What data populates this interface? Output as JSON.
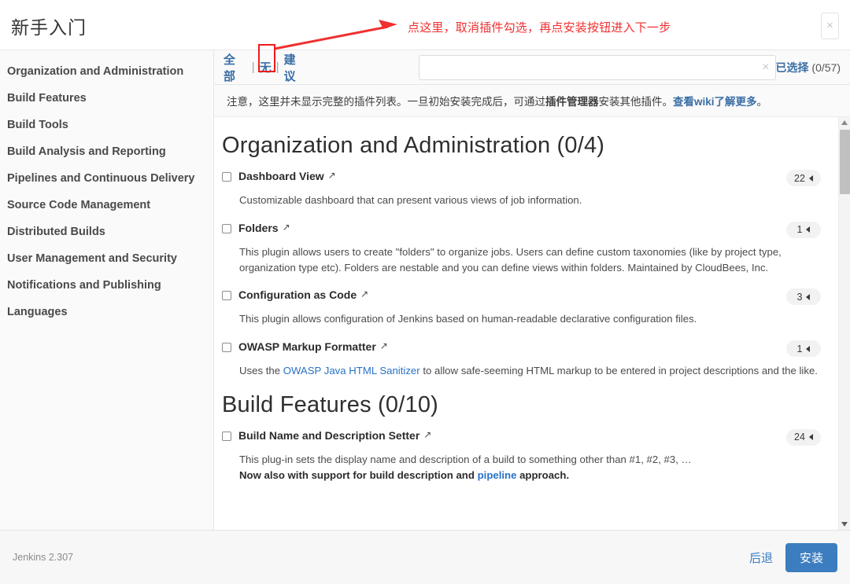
{
  "header": {
    "title": "新手入门",
    "close_label": "×",
    "annotation": "点这里，取消插件勾选，再点安装按钮进入下一步"
  },
  "sidebar": {
    "items": [
      {
        "label": "Organization and Administration"
      },
      {
        "label": "Build Features"
      },
      {
        "label": "Build Tools"
      },
      {
        "label": "Build Analysis and Reporting"
      },
      {
        "label": "Pipelines and Continuous Delivery"
      },
      {
        "label": "Source Code Management"
      },
      {
        "label": "Distributed Builds"
      },
      {
        "label": "User Management and Security"
      },
      {
        "label": "Notifications and Publishing"
      },
      {
        "label": "Languages"
      }
    ]
  },
  "filter_bar": {
    "tab_all": "全部",
    "tab_none": "无",
    "tab_suggested": "建议",
    "separator": "|",
    "search_value": "",
    "search_placeholder": "",
    "clear_label": "×",
    "selected_link": "已选择",
    "selected_count": " (0/57)"
  },
  "notice": {
    "part1": "注意，这里并未显示完整的插件列表。一旦初始安装完成后，可通过",
    "bold": "插件管理器",
    "part2": "安装其他插件。",
    "link": "查看wiki了解更多",
    "part3": "。"
  },
  "categories": [
    {
      "title": "Organization and Administration (0/4)",
      "plugins": [
        {
          "name": "Dashboard View",
          "ext_icon": "↗",
          "version": "22",
          "desc_pre": "Customizable dashboard that can present various views of job information.",
          "desc_link": "",
          "desc_post": "",
          "desc_bold": ""
        },
        {
          "name": "Folders",
          "ext_icon": "↗",
          "version": "1",
          "desc_pre": "This plugin allows users to create \"folders\" to organize jobs. Users can define custom taxonomies (like by project type, organization type etc). Folders are nestable and you can define views within folders. Maintained by CloudBees, Inc.",
          "desc_link": "",
          "desc_post": "",
          "desc_bold": ""
        },
        {
          "name": "Configuration as Code",
          "ext_icon": "↗",
          "version": "3",
          "desc_pre": "This plugin allows configuration of Jenkins based on human-readable declarative configuration files.",
          "desc_link": "",
          "desc_post": "",
          "desc_bold": ""
        },
        {
          "name": "OWASP Markup Formatter",
          "ext_icon": "↗",
          "version": "1",
          "desc_pre": "Uses the ",
          "desc_link": "OWASP Java HTML Sanitizer",
          "desc_post": " to allow safe-seeming HTML markup to be entered in project descriptions and the like.",
          "desc_bold": ""
        }
      ]
    },
    {
      "title": "Build Features (0/10)",
      "plugins": [
        {
          "name": "Build Name and Description Setter",
          "ext_icon": "↗",
          "version": "24",
          "desc_pre": "This plug-in sets the display name and description of a build to something other than #1, #2, #3, …",
          "desc_link": "",
          "desc_post": "",
          "desc_bold_pre": "Now also with support for build description and ",
          "desc_bold_link": "pipeline",
          "desc_bold_post": " approach."
        }
      ]
    }
  ],
  "footer": {
    "version": "Jenkins 2.307",
    "back_label": "后退",
    "install_label": "安装"
  },
  "colors": {
    "accent_blue": "#3b7dbf",
    "link_blue": "#2a72c6",
    "annotation_red": "#f03030"
  }
}
